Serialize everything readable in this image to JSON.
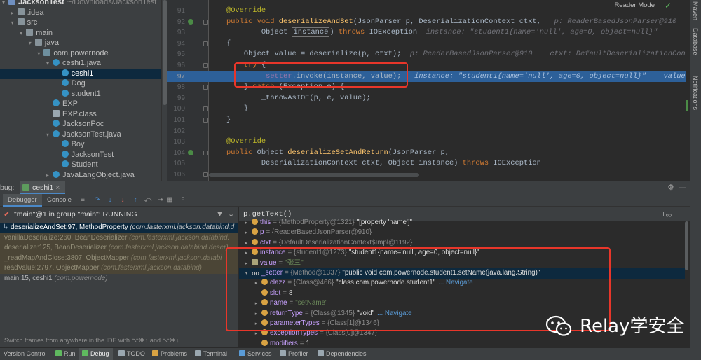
{
  "project_tree": {
    "rows": [
      {
        "label": "JacksonTest",
        "extra": "~/Downloads/JacksonTest",
        "type": "proj",
        "indent": 0,
        "arrow": "▾",
        "selected": false
      },
      {
        "label": ".idea",
        "extra": "",
        "type": "folder",
        "indent": 1,
        "arrow": "▸",
        "selected": false
      },
      {
        "label": "src",
        "extra": "",
        "type": "folder",
        "indent": 1,
        "arrow": "▾",
        "selected": false
      },
      {
        "label": "main",
        "extra": "",
        "type": "folder",
        "indent": 2,
        "arrow": "▾",
        "selected": false
      },
      {
        "label": "java",
        "extra": "",
        "type": "folder",
        "indent": 3,
        "arrow": "▾",
        "selected": false
      },
      {
        "label": "com.powernode",
        "extra": "",
        "type": "pkg",
        "indent": 4,
        "arrow": "▾",
        "selected": false
      },
      {
        "label": "ceshi1.java",
        "extra": "",
        "type": "javaf",
        "indent": 5,
        "arrow": "▾",
        "selected": false
      },
      {
        "label": "ceshi1",
        "extra": "",
        "type": "cls",
        "indent": 6,
        "arrow": "",
        "selected": true
      },
      {
        "label": "Dog",
        "extra": "",
        "type": "cls",
        "indent": 6,
        "arrow": "",
        "selected": false
      },
      {
        "label": "student1",
        "extra": "",
        "type": "cls",
        "indent": 6,
        "arrow": "",
        "selected": false
      },
      {
        "label": "EXP",
        "extra": "",
        "type": "cls",
        "indent": 5,
        "arrow": "",
        "selected": false
      },
      {
        "label": "EXP.class",
        "extra": "",
        "type": "file",
        "indent": 5,
        "arrow": "",
        "selected": false
      },
      {
        "label": "JacksonPoc",
        "extra": "",
        "type": "cls",
        "indent": 5,
        "arrow": "",
        "selected": false
      },
      {
        "label": "JacksonTest.java",
        "extra": "",
        "type": "javaf",
        "indent": 5,
        "arrow": "▾",
        "selected": false
      },
      {
        "label": "Boy",
        "extra": "",
        "type": "cls",
        "indent": 6,
        "arrow": "",
        "selected": false
      },
      {
        "label": "JacksonTest",
        "extra": "",
        "type": "cls",
        "indent": 6,
        "arrow": "",
        "selected": false
      },
      {
        "label": "Student",
        "extra": "",
        "type": "cls",
        "indent": 6,
        "arrow": "",
        "selected": false
      },
      {
        "label": "JavaLangObject.java",
        "extra": "",
        "type": "javaf",
        "indent": 5,
        "arrow": "▸",
        "selected": false
      }
    ]
  },
  "editor": {
    "reader_mode_label": "Reader Mode",
    "line_numbers": [
      "91",
      "92",
      "93",
      "94",
      "95",
      "96",
      "97",
      "98",
      "99",
      "100",
      "101",
      "102",
      "103",
      "104",
      "105",
      "106"
    ],
    "highlight_line": "97",
    "lines": [
      [
        {
          "t": "    ",
          "c": ""
        },
        {
          "t": "@Override",
          "c": "ann"
        }
      ],
      [
        {
          "t": "    ",
          "c": ""
        },
        {
          "t": "public void ",
          "c": "kw"
        },
        {
          "t": "deserializeAndSet",
          "c": "fn"
        },
        {
          "t": "(JsonParser p, DeserializationContext ctxt,   ",
          "c": ""
        },
        {
          "t": "p: ReaderBasedJsonParser@910    ctxt: Def",
          "c": "hint"
        }
      ],
      [
        {
          "t": "            Object ",
          "c": ""
        },
        {
          "t": "instance",
          "c": "boxed"
        },
        {
          "t": ") ",
          "c": ""
        },
        {
          "t": "throws ",
          "c": "kw"
        },
        {
          "t": "IOException  ",
          "c": ""
        },
        {
          "t": "instance: \"student1{name='null', age=0, object=null}\"",
          "c": "hint"
        }
      ],
      [
        {
          "t": "    {",
          "c": ""
        }
      ],
      [
        {
          "t": "        Object value = deserialize(p, ctxt);  ",
          "c": ""
        },
        {
          "t": "p: ReaderBasedJsonParser@910    ctxt: DefaultDeserializationContext$Impl@",
          "c": "hint"
        }
      ],
      [
        {
          "t": "        ",
          "c": ""
        },
        {
          "t": "try ",
          "c": "kw"
        },
        {
          "t": "{",
          "c": ""
        }
      ],
      [
        {
          "t": "            ",
          "c": ""
        },
        {
          "t": "_setter",
          "c": "fld"
        },
        {
          "t": ".invoke(instance, value);   ",
          "c": ""
        },
        {
          "t": "instance: \"student1{name='null', age=0, object=null}\"    value: \"张三\"",
          "c": "hint"
        }
      ],
      [
        {
          "t": "        } ",
          "c": ""
        },
        {
          "t": "catch ",
          "c": "kw"
        },
        {
          "t": "(Exception e) {",
          "c": ""
        }
      ],
      [
        {
          "t": "            _throwAsIOE(p, e, value);",
          "c": ""
        }
      ],
      [
        {
          "t": "        }",
          "c": ""
        }
      ],
      [
        {
          "t": "    }",
          "c": ""
        }
      ],
      [
        {
          "t": "",
          "c": ""
        }
      ],
      [
        {
          "t": "    ",
          "c": ""
        },
        {
          "t": "@Override",
          "c": "ann"
        }
      ],
      [
        {
          "t": "    ",
          "c": ""
        },
        {
          "t": "public ",
          "c": "kw"
        },
        {
          "t": "Object ",
          "c": ""
        },
        {
          "t": "deserializeSetAndReturn",
          "c": "fn"
        },
        {
          "t": "(JsonParser p,",
          "c": ""
        }
      ],
      [
        {
          "t": "            DeserializationContext ctxt, Object instance) ",
          "c": ""
        },
        {
          "t": "throws ",
          "c": "kw"
        },
        {
          "t": "IOException",
          "c": ""
        }
      ],
      [
        {
          "t": "",
          "c": ""
        }
      ]
    ]
  },
  "debug": {
    "header_label": "bug:",
    "session_tab": "ceshi1",
    "tabs": [
      "Debugger",
      "Console"
    ],
    "active_tab": "Debugger",
    "thread": "\"main\"@1 in group \"main\": RUNNING",
    "frames": [
      {
        "method": "deserializeAndSet:97, MethodProperty",
        "pkg": "(com.fasterxml.jackson.databind.d",
        "kind": "sel"
      },
      {
        "method": "vanillaDeserialize:260, BeanDeserializer",
        "pkg": "(com.fasterxml.jackson.databind.",
        "kind": "lib"
      },
      {
        "method": "deserialize:125, BeanDeserializer",
        "pkg": "(com.fasterxml.jackson.databind.deser)",
        "kind": "lib"
      },
      {
        "method": "_readMapAndClose:3807, ObjectMapper",
        "pkg": "(com.fasterxml.jackson.databi",
        "kind": "lib"
      },
      {
        "method": "readValue:2797, ObjectMapper",
        "pkg": "(com.fasterxml.jackson.databind)",
        "kind": "lib"
      },
      {
        "method": "main:15, ceshi1",
        "pkg": "(com.powernode)",
        "kind": "norm"
      }
    ],
    "frames_hint": "Switch frames from anywhere in the IDE with ⌥⌘↑ and ⌥⌘↓",
    "eval_expression": "p.getText()",
    "variables": [
      {
        "indent": 0,
        "exp": "▸",
        "icon": "f",
        "name": "this",
        "type": "= {MethodProperty@1321}",
        "val": "\"[property 'name']\"",
        "nav": "",
        "sel": false
      },
      {
        "indent": 0,
        "exp": "▸",
        "icon": "p",
        "name": "p",
        "type": "= {ReaderBasedJsonParser@910}",
        "val": "",
        "nav": "",
        "sel": false
      },
      {
        "indent": 0,
        "exp": "▸",
        "icon": "p",
        "name": "ctxt",
        "type": "= {DefaultDeserializationContext$Impl@1192}",
        "val": "",
        "nav": "",
        "sel": false
      },
      {
        "indent": 0,
        "exp": "▸",
        "icon": "p",
        "name": "instance",
        "type": "= {student1@1273}",
        "val": "\"student1{name='null', age=0, object=null}\"",
        "nav": "",
        "sel": false
      },
      {
        "indent": 0,
        "exp": "▸",
        "icon": "list",
        "name": "value",
        "type": "=",
        "val": "\"张三\"",
        "nav": "",
        "sel": false,
        "str": true
      },
      {
        "indent": 0,
        "exp": "▾",
        "icon": "oo",
        "name": "_setter",
        "type": "= {Method@1337}",
        "val": "\"public void com.powernode.student1.setName(java.lang.String)\"",
        "nav": "",
        "sel": true
      },
      {
        "indent": 1,
        "exp": "▸",
        "icon": "f",
        "name": "clazz",
        "type": "= {Class@466}",
        "val": "\"class com.powernode.student1\"",
        "nav": "... Navigate",
        "sel": false
      },
      {
        "indent": 1,
        "exp": "",
        "icon": "f",
        "name": "slot",
        "type": "=",
        "val": "8",
        "nav": "",
        "sel": false
      },
      {
        "indent": 1,
        "exp": "▸",
        "icon": "f",
        "name": "name",
        "type": "=",
        "val": "\"setName\"",
        "nav": "",
        "sel": false,
        "str": true
      },
      {
        "indent": 1,
        "exp": "▸",
        "icon": "f",
        "name": "returnType",
        "type": "= {Class@1345}",
        "val": "\"void\"",
        "nav": "... Navigate",
        "sel": false
      },
      {
        "indent": 1,
        "exp": "▸",
        "icon": "f",
        "name": "parameterTypes",
        "type": "= {Class[1]@1346}",
        "val": "",
        "nav": "",
        "sel": false
      },
      {
        "indent": 1,
        "exp": "▸",
        "icon": "f",
        "name": "exceptionTypes",
        "type": "= {Class[0]@1347}",
        "val": "",
        "nav": "",
        "sel": false
      },
      {
        "indent": 1,
        "exp": "",
        "icon": "f",
        "name": "modifiers",
        "type": "=",
        "val": "1",
        "nav": "",
        "sel": false
      }
    ]
  },
  "statusbar": {
    "items": [
      {
        "label": "Version Control",
        "icon": "",
        "active": false
      },
      {
        "label": "Run",
        "icon": "run-icon",
        "active": false
      },
      {
        "label": "Debug",
        "icon": "debug-icon",
        "active": true
      },
      {
        "label": "TODO",
        "icon": "todo-icon",
        "active": false
      },
      {
        "label": "Problems",
        "icon": "problems-icon",
        "active": false
      },
      {
        "label": "Terminal",
        "icon": "terminal-icon",
        "active": false
      },
      {
        "label": "Services",
        "icon": "services-icon",
        "active": false
      },
      {
        "label": "Profiler",
        "icon": "profiler-icon",
        "active": false
      },
      {
        "label": "Dependencies",
        "icon": "dependencies-icon",
        "active": false
      }
    ]
  },
  "right_strip": {
    "tabs": [
      "Maven",
      "Database",
      "Notifications"
    ]
  },
  "watermark": {
    "text": "Relay学安全"
  },
  "colors": {
    "annotation_red": "#e8362a",
    "selection_blue": "#0d293e",
    "highlight_line": "#2d6099",
    "library_frame": "#4b4536"
  }
}
